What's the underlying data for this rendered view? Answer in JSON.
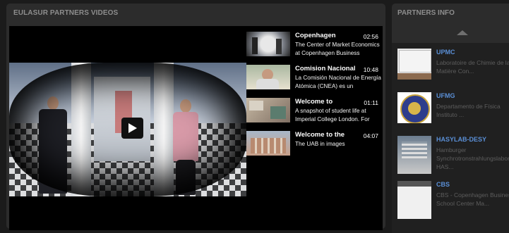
{
  "videos": {
    "title": "EULASUR PARTNERS VIDEOS",
    "playlist": [
      {
        "title": "Copenhagen",
        "duration": "02:56",
        "description": "The Center of Market Economics at Copenhagen Business"
      },
      {
        "title": "Comision Nacional",
        "duration": "10:48",
        "description": "La Comisión Nacional de Energía Atómica (CNEA) es un"
      },
      {
        "title": "Welcome to",
        "duration": "01:11",
        "description": "A snapshot of student life at Imperial College London.  For"
      },
      {
        "title": "Welcome to the",
        "duration": "04:07",
        "description": "The UAB in images"
      }
    ]
  },
  "partners": {
    "title": "PARTNERS INFO",
    "items": [
      {
        "name": "UPMC",
        "description": "Laboratoire de Chimie de la Matière Con..."
      },
      {
        "name": "UFMG",
        "description": "Departamento de Física Instituto ..."
      },
      {
        "name": "HASYLAB-DESY",
        "description": "Hamburger Synchrotronstrahlungslabor HAS..."
      },
      {
        "name": "CBS",
        "description": "CBS - Copenhagen Business School Center Ma..."
      }
    ]
  },
  "colors": {
    "link": "#5a8fd6",
    "panel": "#2c2c2c",
    "background": "#1b1b1b"
  }
}
